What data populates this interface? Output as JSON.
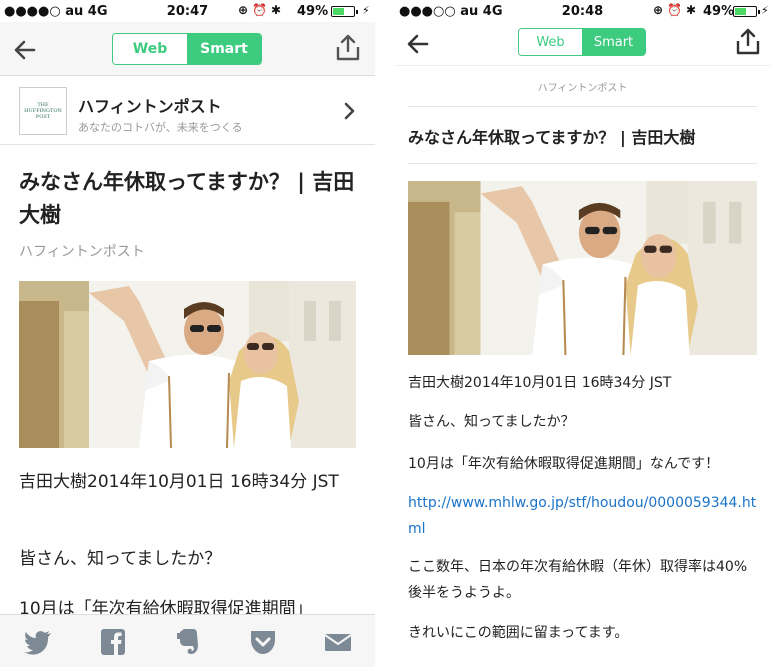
{
  "left": {
    "status": {
      "carrier": "●●●●○ au  4G",
      "time": "20:47",
      "battery": "49%"
    },
    "nav": {
      "web_label": "Web",
      "smart_label": "Smart"
    },
    "source": {
      "logo_text": "THE HUFFINGTON POST",
      "name": "ハフィントンポスト",
      "tagline": "あなたのコトバが、未来をつくる"
    },
    "article": {
      "title": "みなさん年休取ってますか？ | 吉田大樹",
      "source": "ハフィントンポスト",
      "byline": "吉田大樹2014年10月01日 16時34分 JST",
      "p1": "皆さん、知ってましたか？",
      "p2": "10月は「年次有給休暇取得促進期間」"
    },
    "tabbar": {
      "icons": [
        "twitter-icon",
        "facebook-icon",
        "evernote-icon",
        "pocket-icon",
        "mail-icon"
      ]
    }
  },
  "right": {
    "status": {
      "carrier": "●●●○○ au  4G",
      "time": "20:48",
      "battery": "49%"
    },
    "nav": {
      "web_label": "Web",
      "smart_label": "Smart"
    },
    "article": {
      "source": "ハフィントンポスト",
      "title": "みなさん年休取ってますか？ | 吉田大樹",
      "byline": "吉田大樹2014年10月01日 16時34分 JST",
      "p1": "皆さん、知ってましたか？",
      "p2": "10月は「年次有給休暇取得促進期間」なんです！",
      "link": "http://www.mhlw.go.jp/stf/houdou/0000059344.html",
      "p3": "ここ数年、日本の年次有給休暇（年休）取得率は40%後半をうようよ。",
      "p4": "きれいにこの範囲に留まってます。"
    }
  },
  "colors": {
    "accent": "#3ccb7f",
    "link": "#1a73c9"
  }
}
